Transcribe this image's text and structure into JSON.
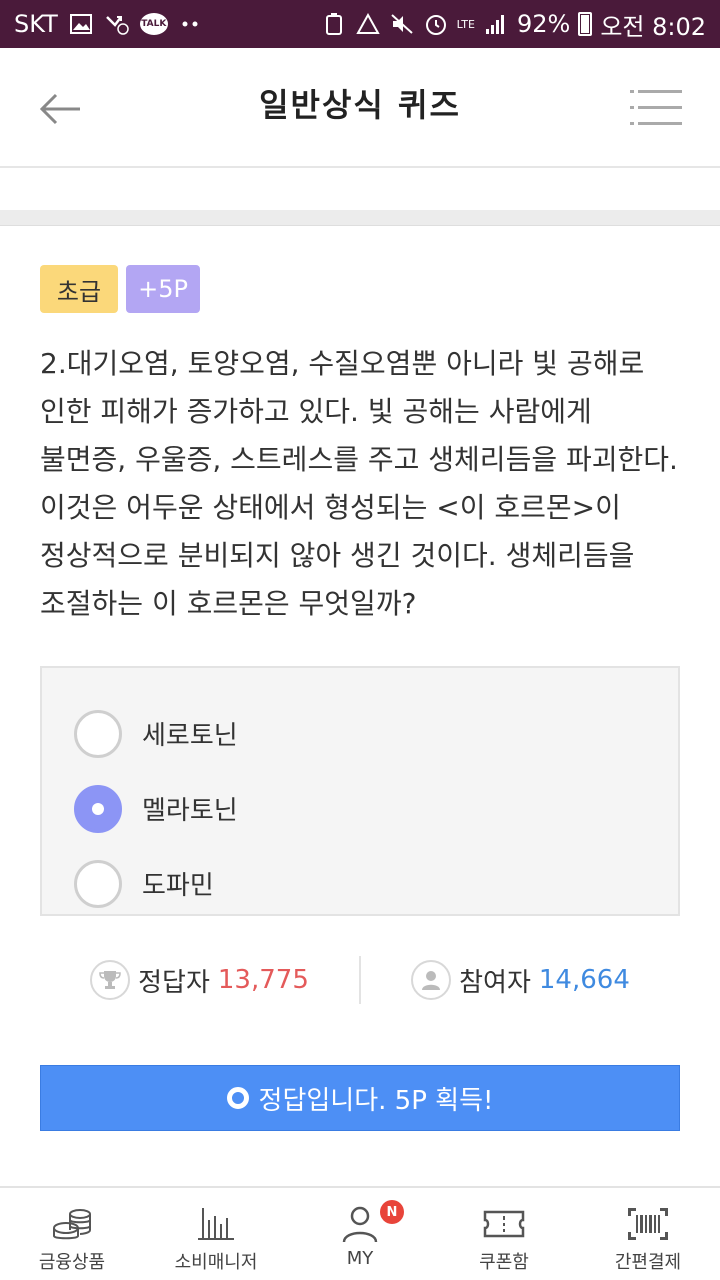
{
  "status_bar": {
    "carrier": "SKT",
    "battery": "92%",
    "time": "오전 8:02",
    "network": "LTE"
  },
  "header": {
    "title": "일반상식 퀴즈"
  },
  "quiz": {
    "level_badge": "초급",
    "point_badge": "+5P",
    "question": "2.대기오염, 토양오염, 수질오염뿐 아니라 빛 공해로 인한 피해가 증가하고 있다. 빛 공해는 사람에게 불면증, 우울증, 스트레스를 주고 생체리듬을 파괴한다. 이것은 어두운 상태에서 형성되는 <이 호르몬>이 정상적으로 분비되지 않아 생긴 것이다. 생체리듬을 조절하는 이 호르몬은 무엇일까?",
    "options": [
      {
        "label": "세로토닌",
        "selected": false
      },
      {
        "label": "멜라토닌",
        "selected": true
      },
      {
        "label": "도파민",
        "selected": false
      }
    ]
  },
  "stats": {
    "correct_label": "정답자",
    "correct_count": "13,775",
    "participants_label": "참여자",
    "participants_count": "14,664"
  },
  "result": {
    "message": "정답입니다. 5P 획득!"
  },
  "bottom_nav": {
    "items": [
      {
        "label": "금융상품",
        "icon": "coins-icon"
      },
      {
        "label": "소비매니저",
        "icon": "bar-chart-icon"
      },
      {
        "label": "MY",
        "icon": "user-icon",
        "badge": "N"
      },
      {
        "label": "쿠폰함",
        "icon": "ticket-icon"
      },
      {
        "label": "간편결제",
        "icon": "barcode-icon"
      }
    ]
  },
  "colors": {
    "status_bar": "#4a1a3a",
    "accent": "#4d8ff5",
    "selected_radio": "#8c95f5",
    "level_badge": "#fbd87a",
    "point_badge": "#b3a6f3",
    "correct_count": "#e45a5a",
    "participants_count": "#3f8ae0"
  }
}
